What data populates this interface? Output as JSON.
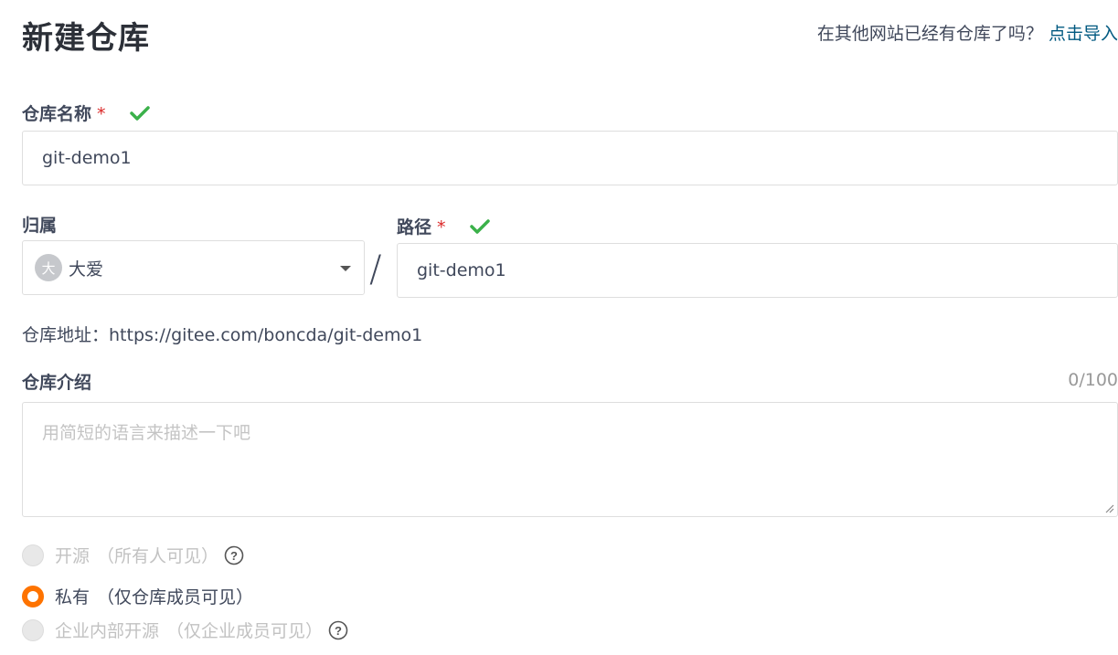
{
  "header": {
    "title": "新建仓库",
    "import_prompt": "在其他网站已经有仓库了吗？",
    "import_link": "点击导入"
  },
  "repo_name": {
    "label": "仓库名称",
    "required_mark": "*",
    "value": "git-demo1",
    "valid": true
  },
  "owner": {
    "label": "归属",
    "avatar_initial": "大",
    "selected": "大爱"
  },
  "separator": "/",
  "path": {
    "label": "路径",
    "required_mark": "*",
    "value": "git-demo1",
    "valid": true
  },
  "address": {
    "label": "仓库地址：",
    "url": "https://gitee.com/boncda/git-demo1"
  },
  "description": {
    "label": "仓库介绍",
    "counter": "0/100",
    "placeholder": "用简短的语言来描述一下吧"
  },
  "visibility": {
    "options": [
      {
        "label": "开源",
        "note": "（所有人可见）",
        "selected": false,
        "disabled": true,
        "has_help": true
      },
      {
        "label": "私有",
        "note": "（仅仓库成员可见）",
        "selected": true,
        "disabled": false,
        "has_help": false
      },
      {
        "label": "企业内部开源",
        "note": "（仅企业成员可见）",
        "selected": false,
        "disabled": true,
        "has_help": true
      }
    ]
  },
  "colors": {
    "accent": "#fe7300",
    "link": "#005980",
    "valid_check": "#3bb14a",
    "required": "#db2828"
  },
  "icons": {
    "valid": "check-icon",
    "dropdown": "caret-down-icon",
    "help": "question-circle-icon"
  }
}
